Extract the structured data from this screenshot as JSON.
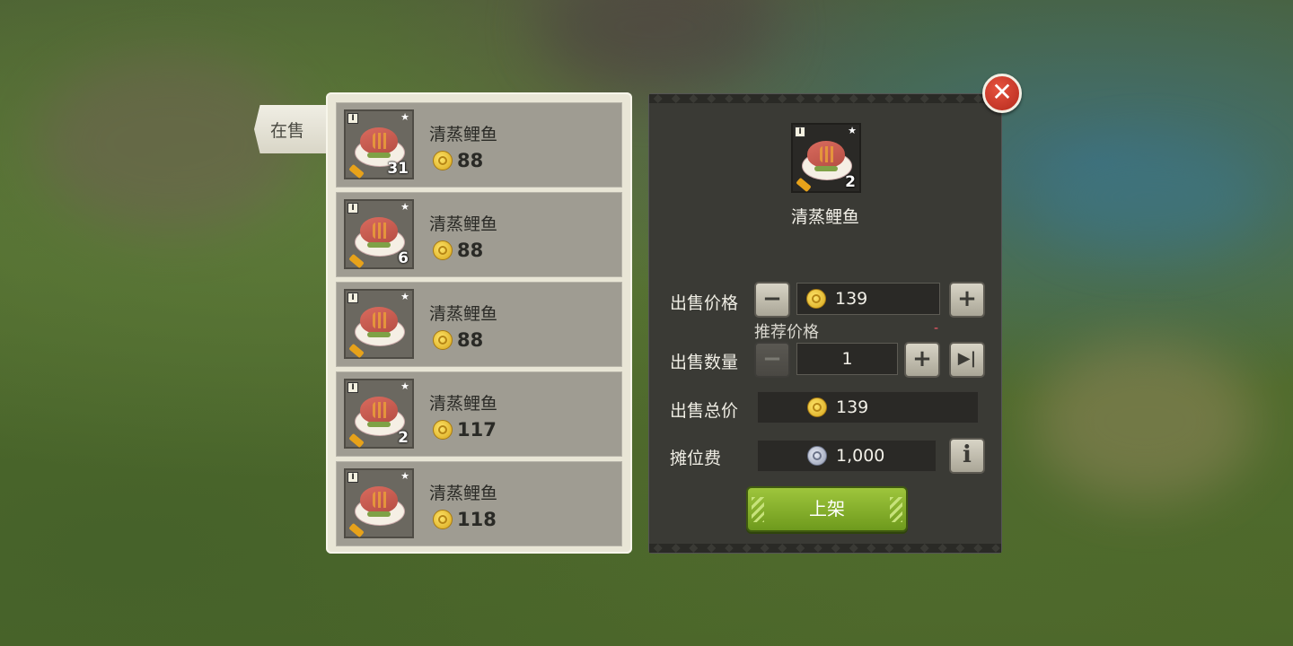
{
  "tab": {
    "label": "在售"
  },
  "listings": [
    {
      "name": "清蒸鲤鱼",
      "price": "88",
      "count": "31"
    },
    {
      "name": "清蒸鲤鱼",
      "price": "88",
      "count": "6"
    },
    {
      "name": "清蒸鲤鱼",
      "price": "88",
      "count": ""
    },
    {
      "name": "清蒸鲤鱼",
      "price": "117",
      "count": "2"
    },
    {
      "name": "清蒸鲤鱼",
      "price": "118",
      "count": ""
    }
  ],
  "slot_tag": "I",
  "detail": {
    "item_name": "清蒸鲤鱼",
    "item_count": "2",
    "sell_price_label": "出售价格",
    "sell_price_value": "139",
    "recommend_label": "推荐价格",
    "recommend_marker": "-",
    "sell_qty_label": "出售数量",
    "sell_qty_value": "1",
    "total_label": "出售总价",
    "total_value": "139",
    "fee_label": "摊位费",
    "fee_value": "1,000",
    "list_button": "上架"
  },
  "buttons": {
    "minus": "−",
    "plus": "+",
    "max": "▶|",
    "info": "i",
    "close": "✕"
  },
  "colors": {
    "list_button": "#8ab42e",
    "close_button": "#d23b2b",
    "panel_dark": "#3a3a35"
  }
}
